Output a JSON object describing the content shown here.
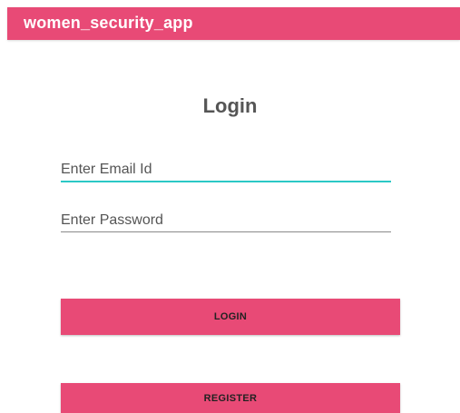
{
  "app_bar": {
    "title": "women_security_app"
  },
  "login_form": {
    "heading": "Login",
    "email_placeholder": "Enter Email Id",
    "password_placeholder": "Enter Password",
    "login_label": "LOGIN",
    "register_label": "REGISTER"
  },
  "colors": {
    "primary": "#e84a76",
    "focus_underline": "#2bc8c6"
  }
}
